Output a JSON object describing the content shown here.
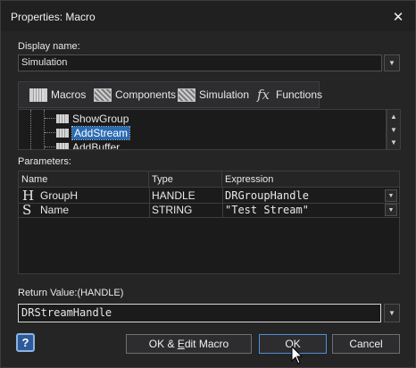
{
  "window": {
    "title": "Properties: Macro"
  },
  "display_name": {
    "label": "Display name:",
    "value": "Simulation"
  },
  "tabs": [
    {
      "label": "Macros",
      "icon": "macro-icon"
    },
    {
      "label": "Components",
      "icon": "component-icon"
    },
    {
      "label": "Simulation",
      "icon": "simulation-icon"
    },
    {
      "label": "Functions",
      "icon": "fx-icon"
    }
  ],
  "tree": {
    "items": [
      {
        "label": "ShowGroup"
      },
      {
        "label": "AddStream",
        "selected": true
      },
      {
        "label": "AddBuffer"
      }
    ]
  },
  "parameters": {
    "label": "Parameters:",
    "columns": [
      "Name",
      "Type",
      "Expression"
    ],
    "rows": [
      {
        "icon": "H",
        "name": "GroupH",
        "type": "HANDLE",
        "expression": "DRGroupHandle"
      },
      {
        "icon": "S",
        "name": "Name",
        "type": "STRING",
        "expression": "\"Test Stream\""
      }
    ]
  },
  "return_value": {
    "label": "Return Value:(HANDLE)",
    "value": "DRStreamHandle"
  },
  "buttons": {
    "help": "?",
    "ok_edit_pre": "OK & ",
    "ok_edit_underline": "E",
    "ok_edit_post": "dit Macro",
    "ok": "OK",
    "cancel": "Cancel"
  },
  "colors": {
    "background": "#252526",
    "selection": "#2a6cb3",
    "help_blue": "#2d5a9a"
  }
}
